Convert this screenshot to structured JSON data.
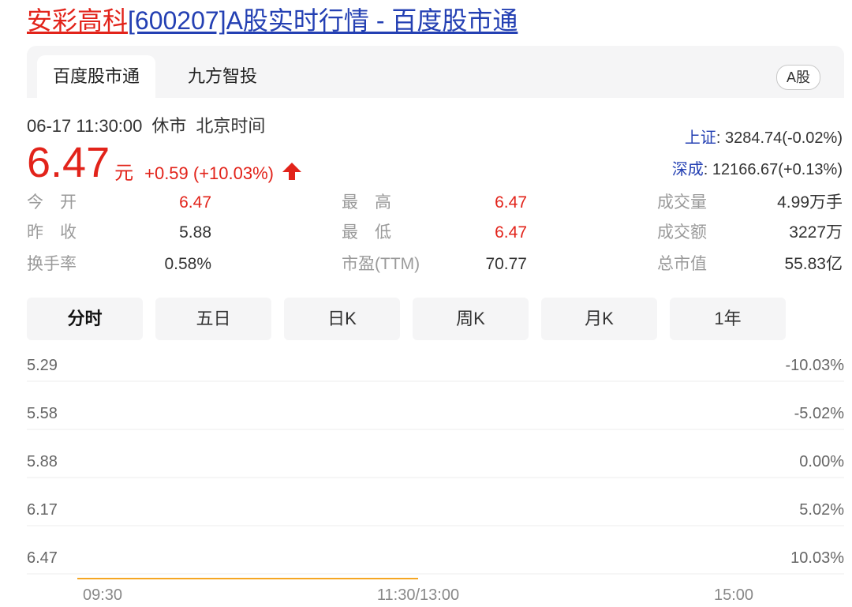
{
  "title": {
    "name": "安彩高科",
    "rest": "[600207]A股实时行情 - 百度股市通"
  },
  "tabs": [
    {
      "label": "百度股市通",
      "active": true
    },
    {
      "label": "九方智投",
      "active": false
    }
  ],
  "market_badge": "A股",
  "quote": {
    "time": "06-17 11:30:00",
    "status": "休市",
    "timezone": "北京时间",
    "price": "6.47",
    "unit": "元",
    "change": "+0.59 (+10.03%)"
  },
  "indices": [
    {
      "name": "上证",
      "value": ": 3284.74(-0.02%)"
    },
    {
      "name": "深成",
      "value": ": 12166.67(+0.13%)"
    }
  ],
  "stats": [
    {
      "label": "今　开",
      "value": "6.47",
      "highlight": true
    },
    {
      "label": "最　高",
      "value": "6.47",
      "highlight": true
    },
    {
      "label": "成交量",
      "value": "4.99万手",
      "highlight": false
    },
    {
      "label": "昨　收",
      "value": "5.88",
      "highlight": false
    },
    {
      "label": "最　低",
      "value": "6.47",
      "highlight": true
    },
    {
      "label": "成交额",
      "value": "3227万",
      "highlight": false
    },
    {
      "label": "换手率",
      "value": "0.58%",
      "highlight": false
    },
    {
      "label": "市盈(TTM)",
      "value": "70.77",
      "highlight": false
    },
    {
      "label": "总市值",
      "value": "55.83亿",
      "highlight": false
    }
  ],
  "period_tabs": [
    {
      "label": "分时",
      "active": true
    },
    {
      "label": "五日",
      "active": false
    },
    {
      "label": "日K",
      "active": false
    },
    {
      "label": "周K",
      "active": false
    },
    {
      "label": "月K",
      "active": false
    },
    {
      "label": "1年",
      "active": false
    }
  ],
  "chart_data": {
    "type": "line",
    "price_ticks": [
      "5.29",
      "5.58",
      "5.88",
      "6.17",
      "6.47"
    ],
    "pct_ticks": [
      "-10.03%",
      "-5.02%",
      "0.00%",
      "5.02%",
      "10.03%"
    ],
    "time_ticks": [
      "09:30",
      "11:30/13:00",
      "15:00"
    ],
    "series": [
      {
        "x_range": [
          "09:30",
          "11:30"
        ],
        "values": [
          6.47,
          6.47
        ]
      }
    ],
    "color": "#f5a623",
    "grid": true
  }
}
